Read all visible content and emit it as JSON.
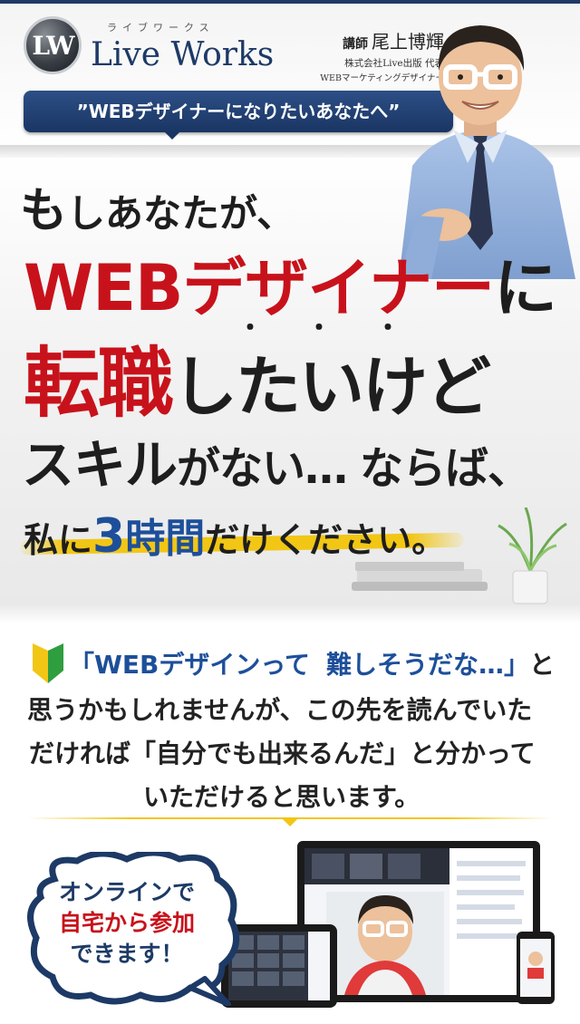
{
  "brand": {
    "logo_mark": "LW",
    "kana": "ライブワークス",
    "name": "Live Works"
  },
  "instructor": {
    "role": "講師",
    "name": "尾上博輝",
    "company": "株式会社Live出版 代表",
    "title": "WEBマーケティングデザイナー"
  },
  "hero": {
    "tagline": "”WEBデザイナーになりたいあなたへ”",
    "line1": {
      "big": "も",
      "rest": "しあなたが、"
    },
    "line2": {
      "red": "WEBデザイナー",
      "black": "に"
    },
    "emphasis_dots": "・・・",
    "line3": {
      "red": "転職",
      "black": "したいけど"
    },
    "line4": {
      "big1": "スキル",
      "mid": "がない…",
      "big2": "ならば、"
    },
    "line5": {
      "pre": "私に",
      "num": "3",
      "big": "時間",
      "post": "だけください。"
    }
  },
  "intro": {
    "quote_open": "「WEBデザインって",
    "quote_close": "難しそうだな…」",
    "quote_after": "と",
    "line2": "思うかもしれませんが、この先を読んでいた",
    "line3": "だければ「自分でも出来るんだ」と分かって",
    "line4": "いただけると思います。"
  },
  "bubble": {
    "line1": "オンラインで",
    "line2": "自宅から参加",
    "line3": "できます！"
  },
  "colors": {
    "navy": "#1d3a66",
    "red": "#c8121b",
    "blue": "#1d4f9a",
    "yellow": "#f2c614"
  },
  "icons": {
    "beginner_mark": "wakaba-beginner-icon"
  }
}
